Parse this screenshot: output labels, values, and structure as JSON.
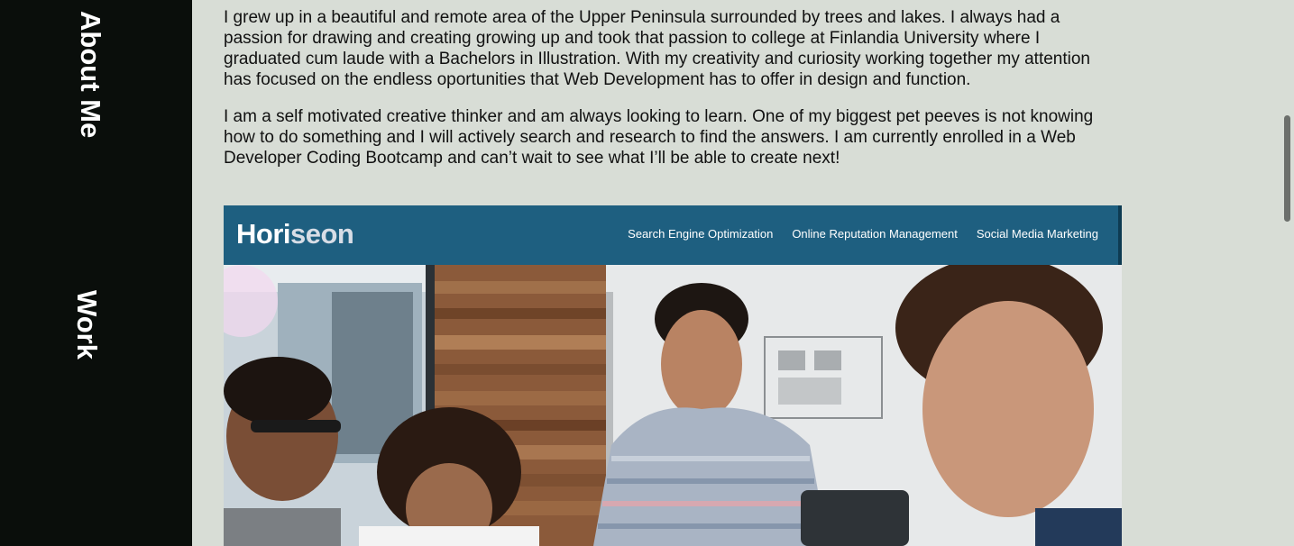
{
  "nav": {
    "about_label": "About Me",
    "work_label": "Work"
  },
  "about": {
    "paragraph_1": "I grew up in a beautiful and remote area of the Upper Peninsula surrounded by trees and lakes. I always had a passion for drawing and creating growing up and took that passion to college at Finlandia University where I graduated cum laude with a Bachelors in Illustration. With my creativity and curiosity working together my attention has focused on the endless oportunities that Web Development has to offer in design and function.",
    "paragraph_2": "I am a self motivated creative thinker and am always looking to learn. One of my biggest pet peeves is not knowing how to do something and I will actively search and research to find the answers. I am currently enrolled in a Web Developer Coding Bootcamp and can’t wait to see what I’ll be able to create next!"
  },
  "project": {
    "logo_part1": "Hori",
    "logo_part2": "seon",
    "nav_items": [
      "Search Engine Optimization",
      "Online Reputation Management",
      "Social Media Marketing"
    ],
    "header_color": "#1e5f80"
  },
  "icons": {
    "hero": "team-meeting-photo"
  }
}
